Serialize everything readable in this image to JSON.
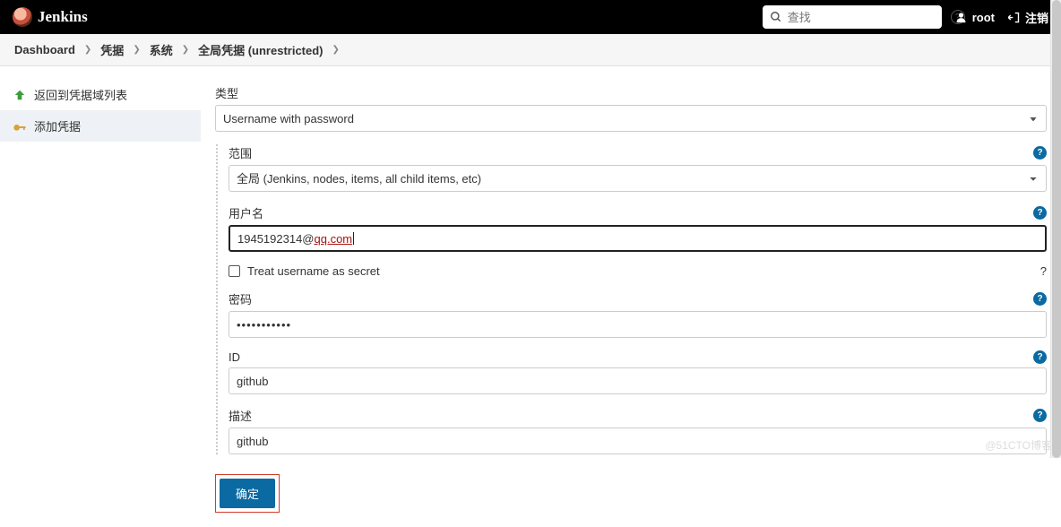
{
  "header": {
    "brand": "Jenkins",
    "search_placeholder": "查找",
    "user": "root",
    "logout": "注销"
  },
  "breadcrumbs": [
    "Dashboard",
    "凭据",
    "系统",
    "全局凭据 (unrestricted)"
  ],
  "sidebar": {
    "items": [
      {
        "label": "返回到凭据域列表"
      },
      {
        "label": "添加凭据"
      }
    ]
  },
  "form": {
    "type_label": "类型",
    "type_value": "Username with password",
    "scope_label": "范围",
    "scope_value": "全局 (Jenkins, nodes, items, all child items, etc)",
    "username_label": "用户名",
    "username_prefix": "1945192314@",
    "username_link": "qq.com",
    "treat_secret_label": "Treat username as secret",
    "password_label": "密码",
    "password_value": "•••••••••••",
    "id_label": "ID",
    "id_value": "github",
    "desc_label": "描述",
    "desc_value": "github",
    "submit": "确定"
  },
  "watermark": "@51CTO博客"
}
